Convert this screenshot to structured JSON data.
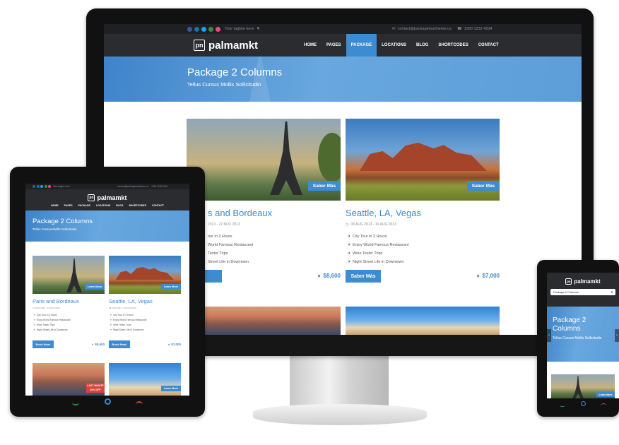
{
  "site": {
    "tagline": "Your tagline here",
    "email": "contact@packagetourtheme.us",
    "phone": "1990 1232 4234",
    "logo_mark": "pn",
    "logo_text": "palmamkt",
    "menu": [
      "HOME",
      "PAGES",
      "PACKAGE",
      "LOCATIONS",
      "BLOG",
      "SHORTCODES",
      "CONTACT"
    ],
    "active_menu": "PACKAGE",
    "banner_title": "Package 2 Columns",
    "banner_subtitle": "Tellus Cursus Mollis Sollicitudin",
    "mobile_select": "Package 2 Columns",
    "cards": [
      {
        "title": "Paris and Bordeaux",
        "title_partial": "s and Bordeaux",
        "date": "11 NOV 2013 - 22 NOV 2013",
        "date_partial": "2013 - 22 NOV 2013",
        "features": [
          "City Tour in 3 Hours",
          "Enjoy World Famous Restaurant",
          "Wine Tester Trips",
          "Night Street Life in Downtown"
        ],
        "features_partial": [
          "our in 3 Hours",
          "World Famous Restaurant",
          "Tester Trips",
          "Street Life in Downtown"
        ],
        "more_label": "Saber Más",
        "more_label_tablet": "Learn More",
        "book_label": "Book Now!",
        "price": "$8,600"
      },
      {
        "title": "Seattle, LA, Vegas",
        "date": "08 AUG 2013 - 16 AUG 2013",
        "features": [
          "City Tour in 3 Hours",
          "Enjoy World Famous Restaurant",
          "Wine Tester Trips",
          "Night Street Life in Downtown"
        ],
        "more_label": "Saber Más",
        "more_label_tablet": "Learn More",
        "book_label": "Saber Más",
        "book_label_tablet": "Book Now!",
        "price": "$7,000"
      }
    ],
    "sale_label": "LAST MINUTE",
    "sale_value": "30% OFF",
    "mobile_more": "Learn More"
  },
  "colors": {
    "accent": "#3d8bd0",
    "topbar": "#1f2024",
    "navbar": "#2b2c30",
    "sale": "#d9443a"
  },
  "icons": {
    "social": [
      "facebook-icon",
      "linkedin-icon",
      "twitter-icon",
      "flickr-icon",
      "dribbble-icon"
    ],
    "email": "envelope-icon",
    "phone": "phone-icon",
    "calendar": "calendar-icon",
    "feature": "plane-icon",
    "price": "tag-icon"
  }
}
